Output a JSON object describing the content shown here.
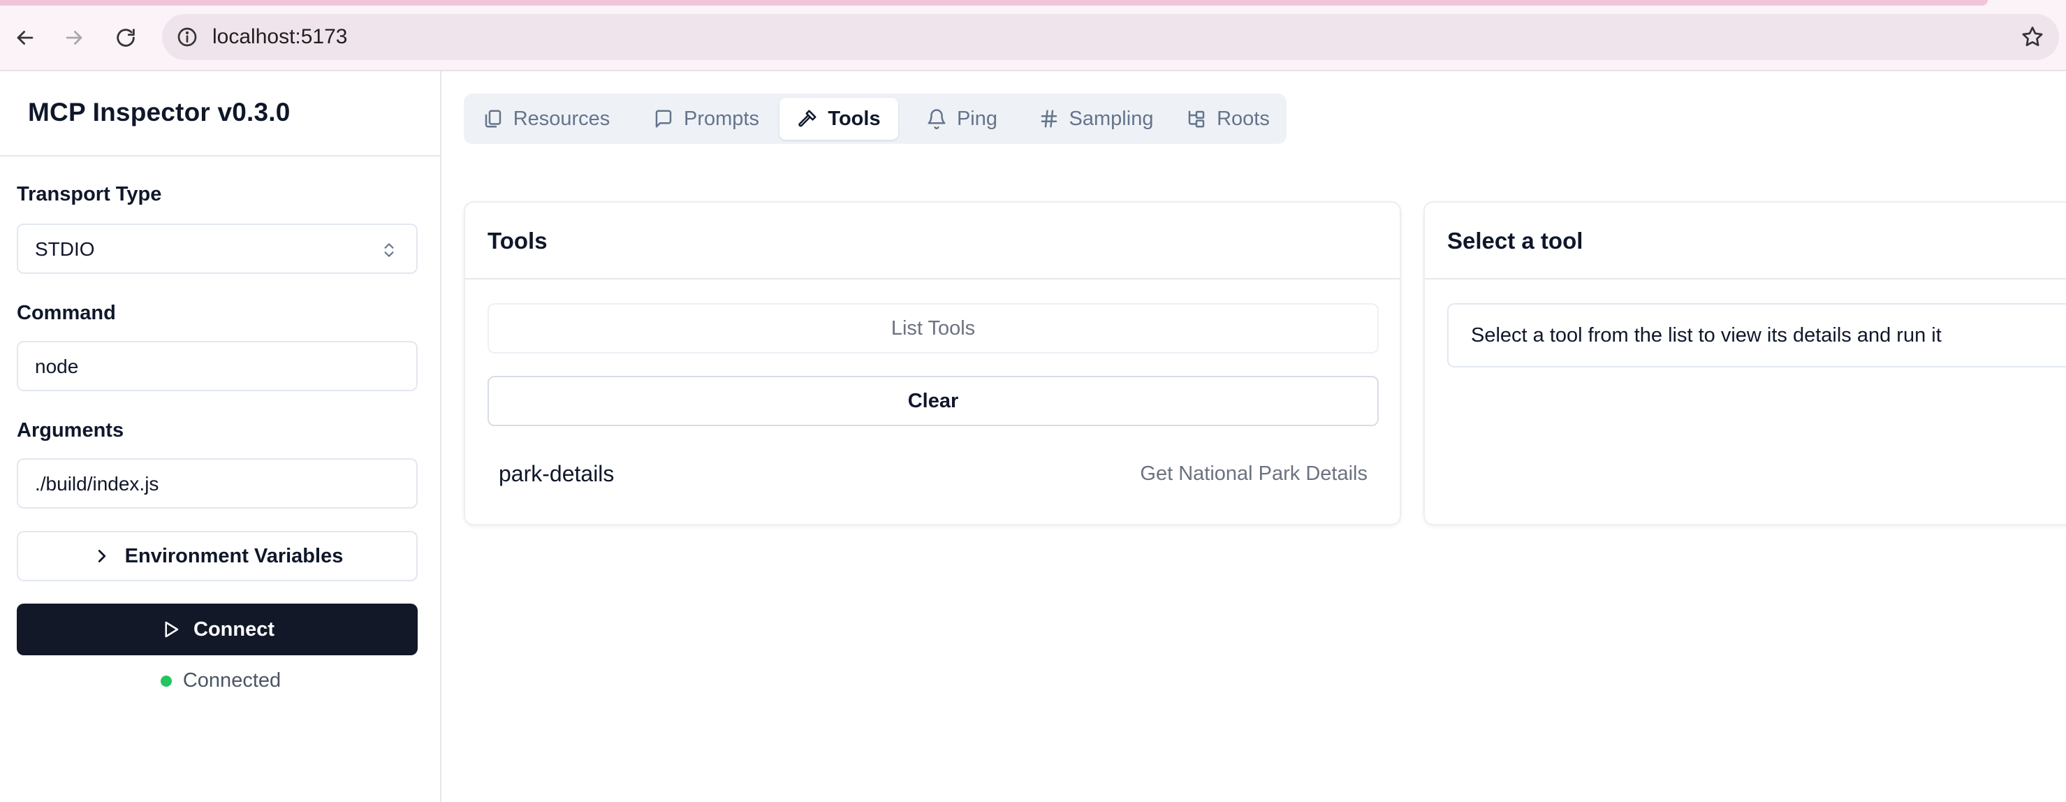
{
  "browser": {
    "url": "localhost:5173"
  },
  "sidebar": {
    "app_title": "MCP Inspector v0.3.0",
    "transport_label": "Transport Type",
    "transport_value": "STDIO",
    "command_label": "Command",
    "command_value": "node",
    "arguments_label": "Arguments",
    "arguments_value": "./build/index.js",
    "env_button_label": "Environment Variables",
    "connect_button_label": "Connect",
    "status_text": "Connected",
    "status_color": "#22c55e"
  },
  "tabs": [
    {
      "label": "Resources",
      "icon": "files-icon",
      "active": false
    },
    {
      "label": "Prompts",
      "icon": "message-square-icon",
      "active": false
    },
    {
      "label": "Tools",
      "icon": "hammer-icon",
      "active": true
    },
    {
      "label": "Ping",
      "icon": "bell-icon",
      "active": false
    },
    {
      "label": "Sampling",
      "icon": "hash-icon",
      "active": false
    },
    {
      "label": "Roots",
      "icon": "folder-tree-icon",
      "active": false
    }
  ],
  "tools_panel": {
    "title": "Tools",
    "list_button_label": "List Tools",
    "clear_button_label": "Clear",
    "items": [
      {
        "name": "park-details",
        "description": "Get National Park Details"
      }
    ]
  },
  "detail_panel": {
    "title": "Select a tool",
    "hint": "Select a tool from the list to view its details and run it"
  },
  "colors": {
    "primary_button": "#121828",
    "accent_strip": "#f1c4dc"
  }
}
